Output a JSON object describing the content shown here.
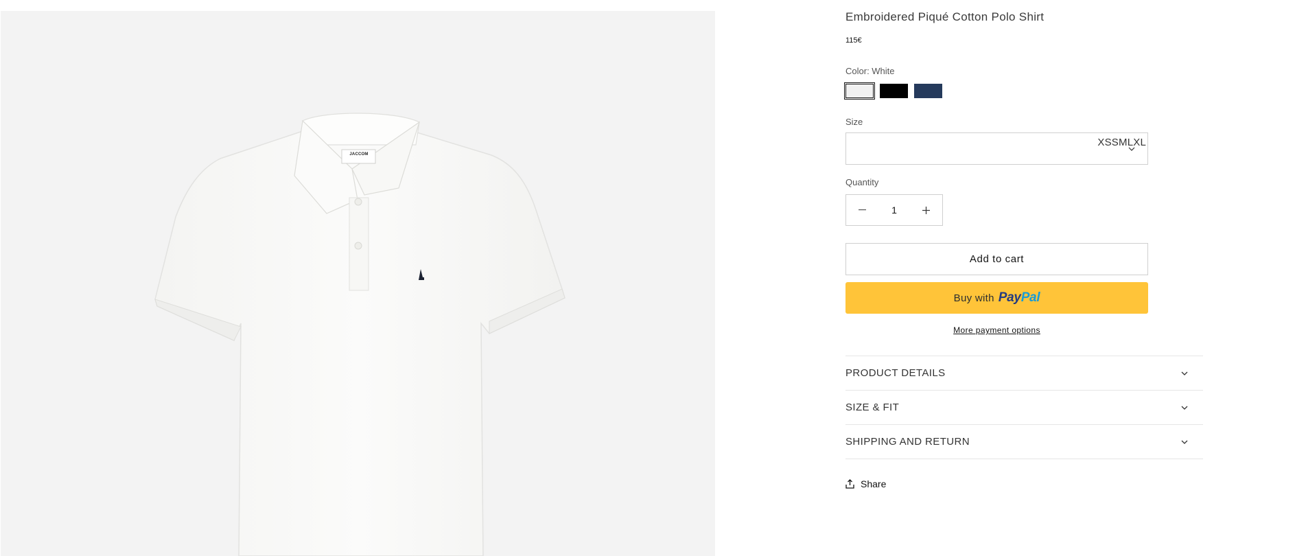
{
  "product": {
    "title": "Embroidered Piqué Cotton Polo Shirt",
    "price": "115€",
    "shirt_label": "JACCOM",
    "shirt_label_sub": "—"
  },
  "color": {
    "label": "Color: White",
    "options": [
      {
        "name": "White",
        "hex": "#f1f1f1",
        "selected": true
      },
      {
        "name": "Black",
        "hex": "#000000",
        "selected": false
      },
      {
        "name": "Navy",
        "hex": "#253a5c",
        "selected": false
      }
    ]
  },
  "size": {
    "label": "Size",
    "options_text": "XSSMLXL"
  },
  "quantity": {
    "label": "Quantity",
    "value": "1"
  },
  "buttons": {
    "add_to_cart": "Add to cart",
    "buy_with": "Buy with",
    "paypal_a": "Pay",
    "paypal_b": "Pal",
    "more_payment": "More payment options"
  },
  "accordion": [
    {
      "title": "PRODUCT DETAILS"
    },
    {
      "title": "SIZE & FIT"
    },
    {
      "title": "SHIPPING AND RETURN"
    }
  ],
  "share": {
    "label": "Share"
  },
  "colors": {
    "paypal_yellow": "#ffc439",
    "paypal_dark_blue": "#253b80",
    "paypal_light_blue": "#179bd7",
    "media_bg": "#f3f3f3"
  }
}
